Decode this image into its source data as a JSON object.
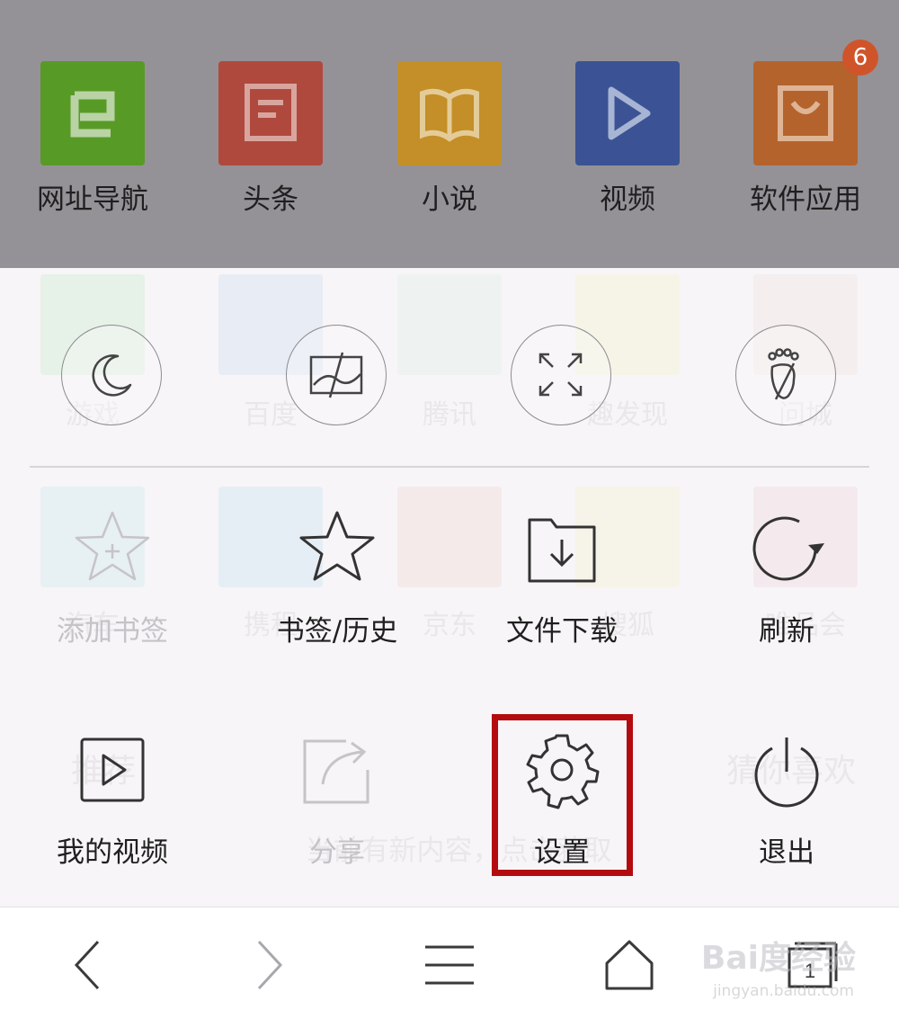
{
  "top_apps": [
    {
      "label": "网址导航",
      "color": "#589a26",
      "icon": "e-icon"
    },
    {
      "label": "头条",
      "color": "#b0493d",
      "icon": "news-icon"
    },
    {
      "label": "小说",
      "color": "#c48f28",
      "icon": "book-icon"
    },
    {
      "label": "视频",
      "color": "#3b5394",
      "icon": "play-icon"
    },
    {
      "label": "软件应用",
      "color": "#b5632d",
      "icon": "bag-icon",
      "badge": "6"
    }
  ],
  "background_sites_row1": [
    "游戏",
    "百度",
    "腾讯",
    "趣发现",
    "问城"
  ],
  "background_sites_row2": [
    "汽车",
    "携程",
    "京东",
    "搜狐",
    "唯品会"
  ],
  "background_tabs": [
    "推荐",
    "猜你喜欢"
  ],
  "background_hint": "当前有新内容，点击获取",
  "menu_toggles": [
    {
      "name": "night-mode-icon"
    },
    {
      "name": "no-image-mode-icon"
    },
    {
      "name": "fullscreen-icon"
    },
    {
      "name": "incognito-icon"
    }
  ],
  "menu_row1": [
    {
      "label": "添加书签",
      "disabled": true
    },
    {
      "label": "书签/历史",
      "disabled": false
    },
    {
      "label": "文件下载",
      "disabled": false
    },
    {
      "label": "刷新",
      "disabled": false
    }
  ],
  "menu_row2": [
    {
      "label": "我的视频",
      "disabled": false
    },
    {
      "label": "分享",
      "disabled": true
    },
    {
      "label": "设置",
      "disabled": false
    },
    {
      "label": "退出",
      "disabled": false
    }
  ],
  "tab_count": "1",
  "watermark": "Bai度经验",
  "watermark_url": "jingyan.baidu.com",
  "colors": {
    "highlight": "#b30b10",
    "dim_overlay": "#949297"
  }
}
